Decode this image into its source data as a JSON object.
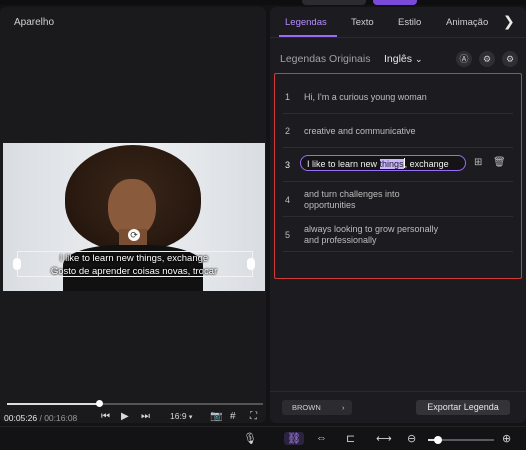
{
  "player": {
    "title": "Aparelho",
    "subtitle_line1": "I like to learn new things, exchange",
    "subtitle_line2": "Gosto de aprender coisas novas, trocar",
    "current_time": "00:05:26",
    "total_time": "00:16:08",
    "separator": " / ",
    "aspect_ratio": "16:9",
    "progress_fraction": 0.36
  },
  "tabs": [
    {
      "label": "Legendas",
      "active": true
    },
    {
      "label": "Texto",
      "active": false
    },
    {
      "label": "Estilo",
      "active": false
    },
    {
      "label": "Animação",
      "active": false
    }
  ],
  "subtitles_panel": {
    "original_label": "Legendas Originais",
    "language": "Inglês",
    "rows": [
      {
        "num": "1",
        "line1": "Hi, I'm a curious young woman",
        "line2": ""
      },
      {
        "num": "2",
        "line1": "creative and communicative",
        "line2": ""
      },
      {
        "num": "3",
        "before": "I like to learn new ",
        "highlight": "things",
        "after": ", exchange"
      },
      {
        "num": "4",
        "line1": "and turn challenges into",
        "line2": "opportunities"
      },
      {
        "num": "5",
        "line1": "always looking to grow personally",
        "line2": "and professionally"
      }
    ],
    "style_name": "BROWN",
    "export_label": "Exportar Legenda"
  },
  "toolbar": {
    "zoom_fraction": 0.15
  },
  "colors": {
    "accent": "#9a6cf5",
    "highlight_border": "#d23a3a"
  },
  "icons": {
    "next_tab": "chevron-right",
    "ai": "ai-icon",
    "settings": "gear-icon",
    "add": "plus-icon",
    "delete": "trash-icon"
  }
}
